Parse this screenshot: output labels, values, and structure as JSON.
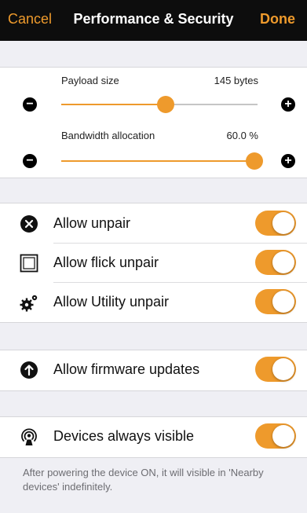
{
  "navbar": {
    "cancel_label": "Cancel",
    "title": "Performance & Security",
    "done_label": "Done"
  },
  "sliders": [
    {
      "label": "Payload size",
      "value": "145 bytes",
      "fraction": 0.53
    },
    {
      "label": "Bandwidth allocation",
      "value": "60.0 %",
      "fraction": 1.0
    }
  ],
  "toggles": [
    {
      "label": "Allow unpair",
      "icon": "x-circle-icon",
      "on": true
    },
    {
      "label": "Allow flick unpair",
      "icon": "square-outline-icon",
      "on": true
    },
    {
      "label": "Allow Utility unpair",
      "icon": "gears-icon",
      "on": true
    }
  ],
  "firmware": {
    "label": "Allow firmware updates",
    "icon": "arrow-up-circle-icon",
    "on": true
  },
  "visibility": {
    "label": "Devices always visible",
    "icon": "broadcast-icon",
    "on": true,
    "footer": "After powering the device ON, it will visible in 'Nearby devices' indefinitely."
  },
  "colors": {
    "accent": "#ee9a2c",
    "navbar_bg": "#0d0d0d",
    "group_bg": "#efeff4"
  }
}
